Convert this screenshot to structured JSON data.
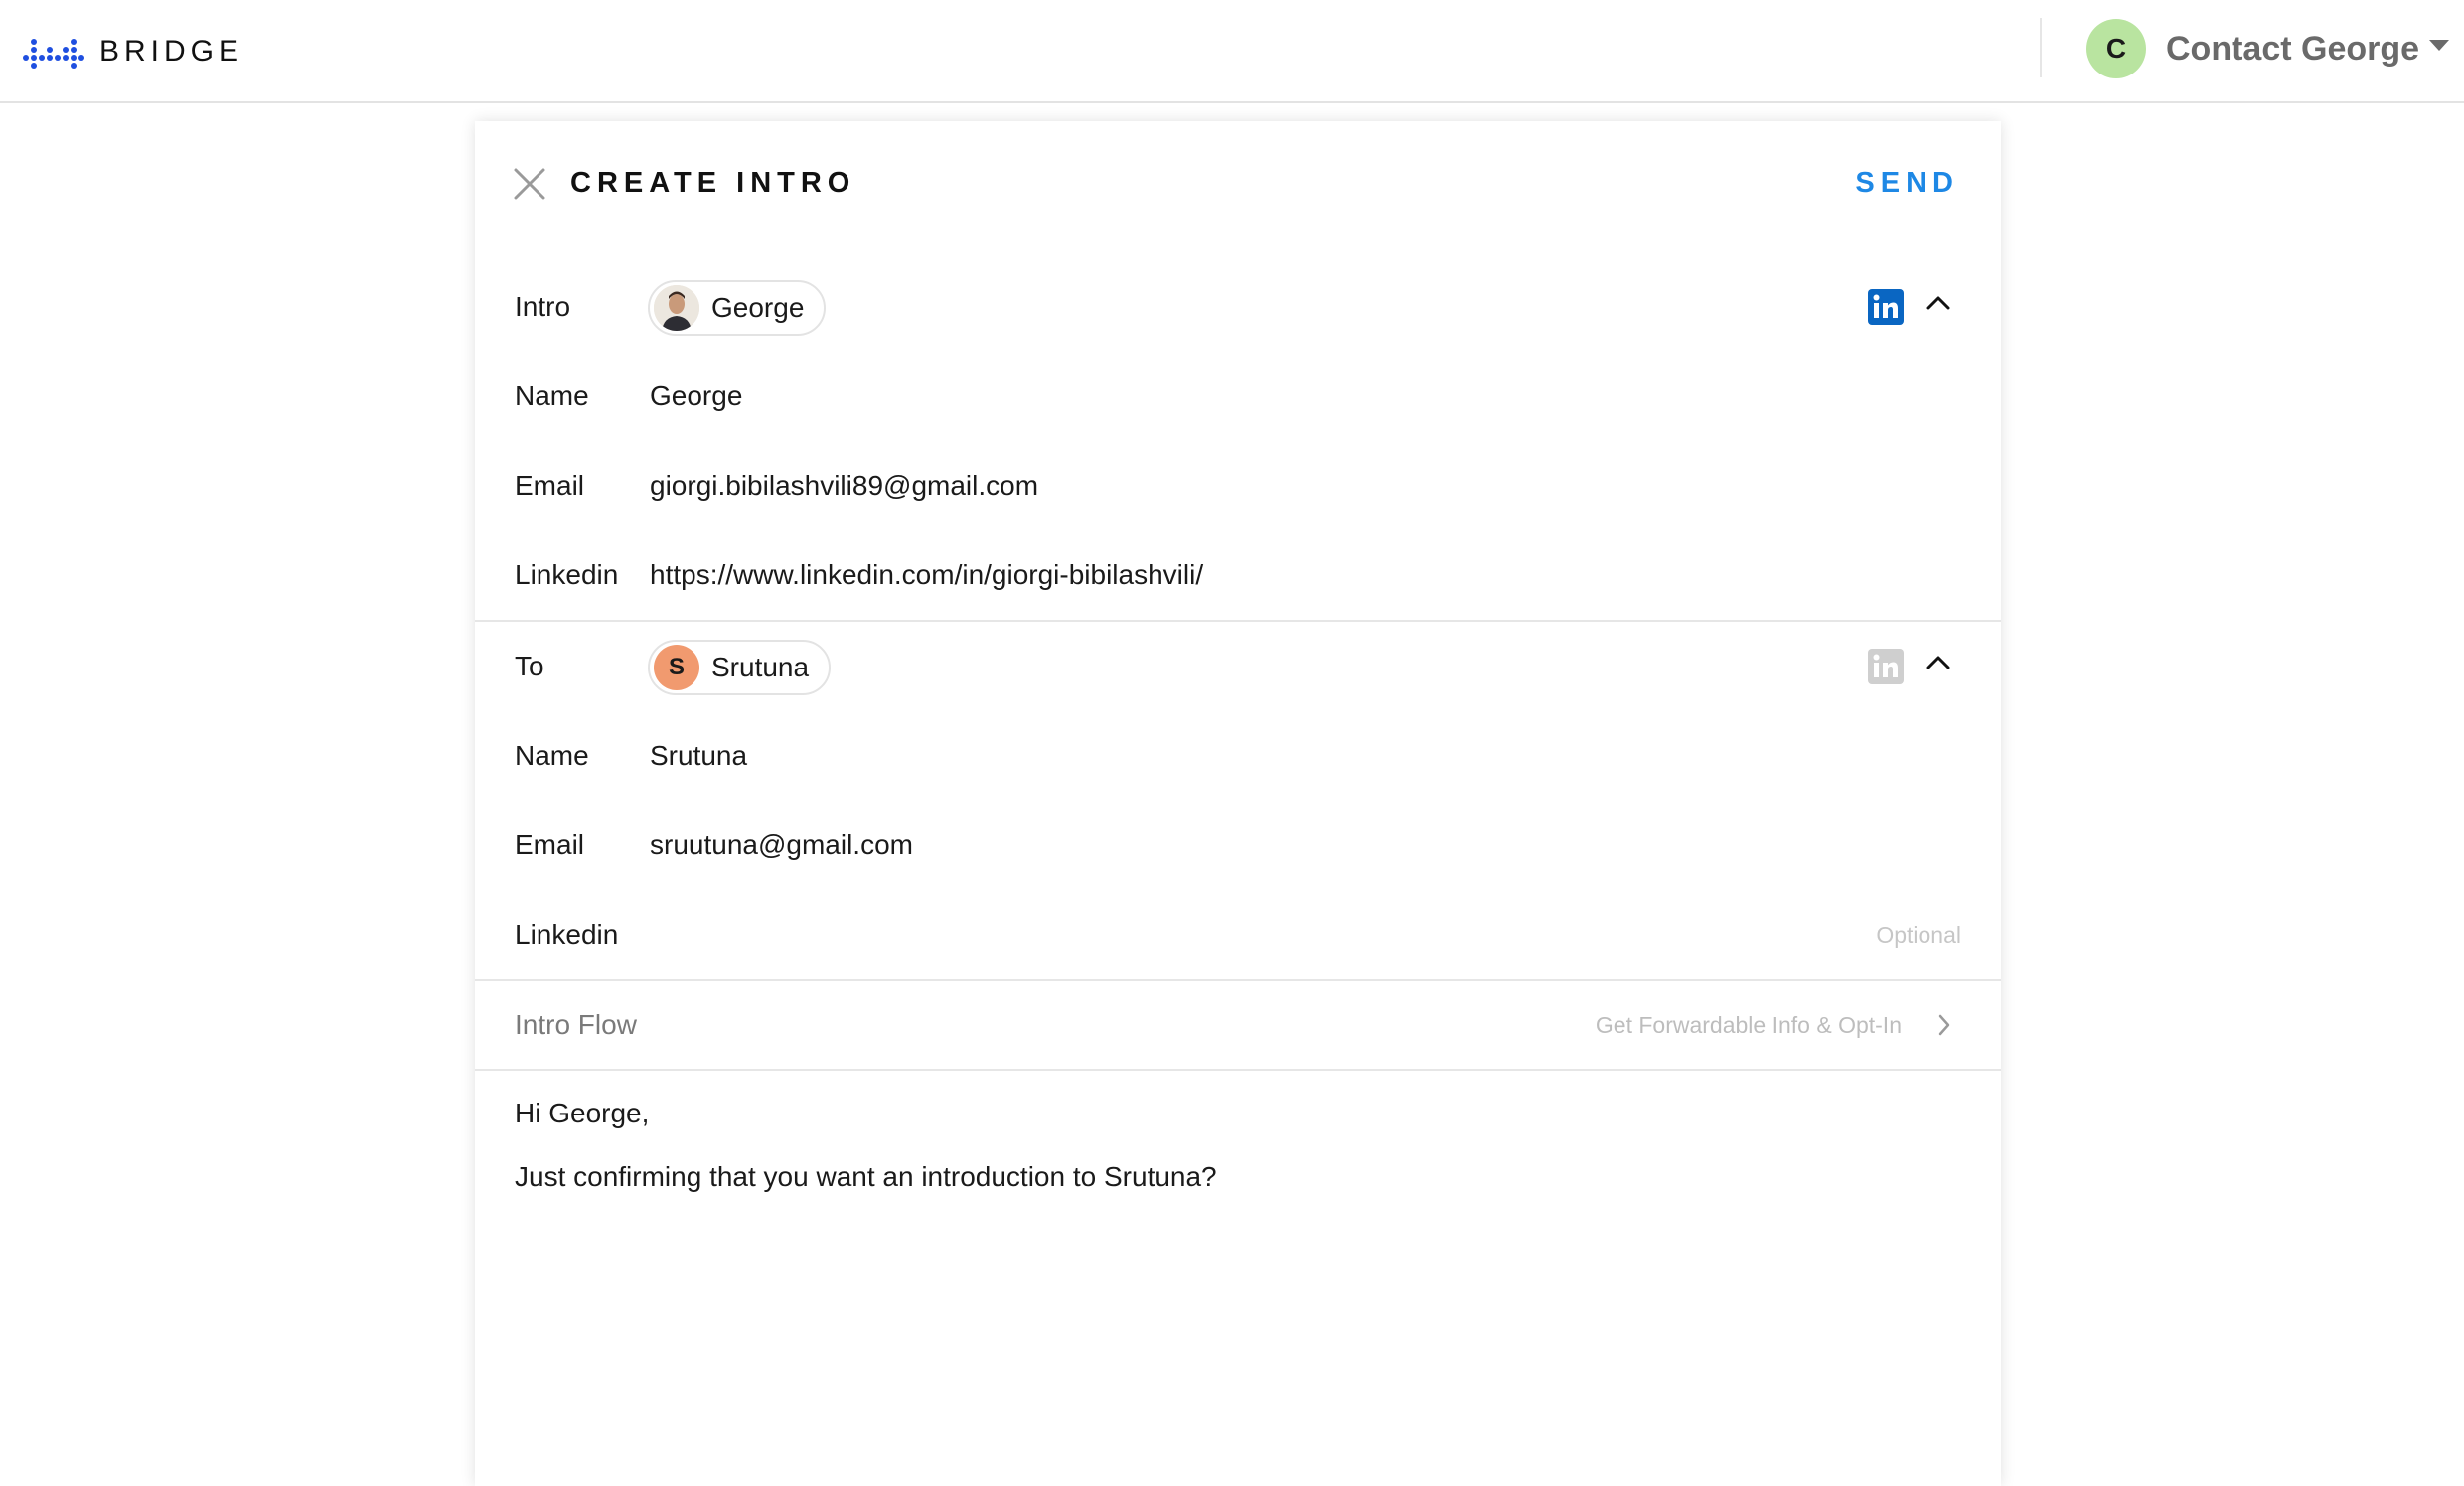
{
  "header": {
    "brand": "BRIDGE",
    "brand_color": "#1f4fe0",
    "account_initial": "C",
    "account_name": "Contact George",
    "account_avatar_color": "#b9e4a0"
  },
  "card": {
    "title": "CREATE INTRO",
    "send_label": "SEND",
    "accent_color": "#1e88e5"
  },
  "intro": {
    "label": "Intro",
    "chip_name": "George",
    "name_label": "Name",
    "name_value": "George",
    "email_label": "Email",
    "email_value": "giorgi.bibilashvili89@gmail.com",
    "linkedin_label": "Linkedin",
    "linkedin_value": "https://www.linkedin.com/in/giorgi-bibilashvili/",
    "linkedin_icon": "linkedin-icon",
    "linkedin_active": true
  },
  "to": {
    "label": "To",
    "chip_initial": "S",
    "chip_name": "Srutuna",
    "chip_color": "#f19a6f",
    "name_label": "Name",
    "name_value": "Srutuna",
    "email_label": "Email",
    "email_value": "sruutuna@gmail.com",
    "linkedin_label": "Linkedin",
    "linkedin_placeholder": "Optional",
    "linkedin_icon": "linkedin-icon",
    "linkedin_active": false
  },
  "flow": {
    "label": "Intro Flow",
    "value": "Get Forwardable Info & Opt-In"
  },
  "message": {
    "greeting": "Hi George,",
    "body": "Just confirming that you want an introduction to Srutuna?"
  }
}
